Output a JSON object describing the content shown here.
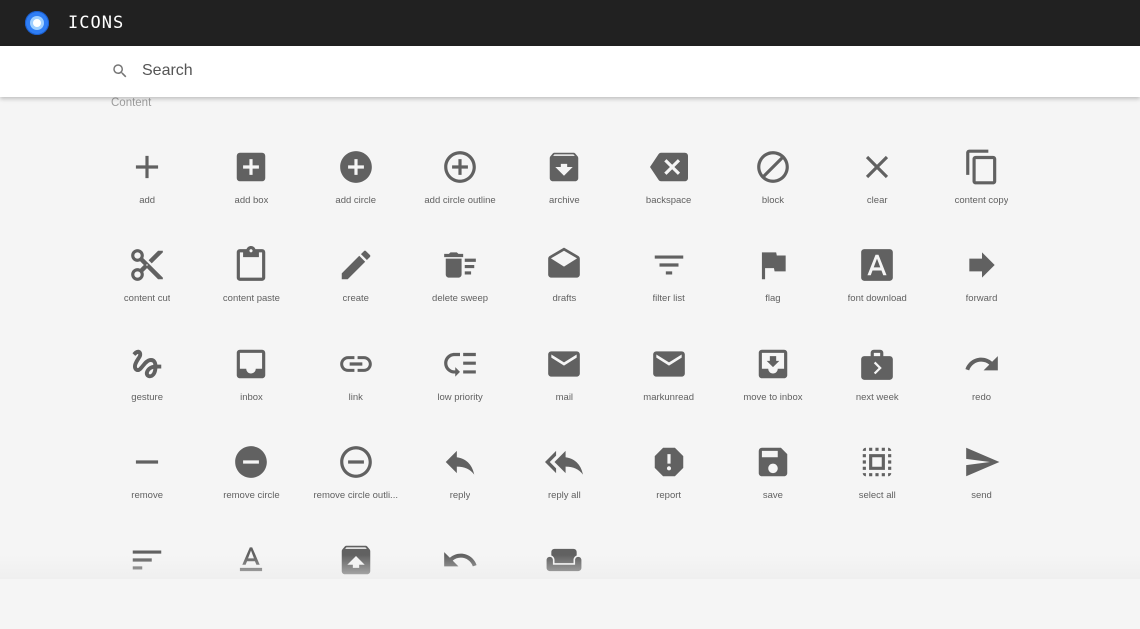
{
  "app": {
    "title": "ICONS"
  },
  "search": {
    "placeholder": "Search",
    "value": ""
  },
  "section": {
    "title": "Content"
  },
  "icon_color": "#616161",
  "icons": [
    {
      "label": "add",
      "icon": "add-icon"
    },
    {
      "label": "add box",
      "icon": "add-box-icon"
    },
    {
      "label": "add circle",
      "icon": "add-circle-icon"
    },
    {
      "label": "add circle outline",
      "icon": "add-circle-outline-icon"
    },
    {
      "label": "archive",
      "icon": "archive-icon"
    },
    {
      "label": "backspace",
      "icon": "backspace-icon"
    },
    {
      "label": "block",
      "icon": "block-icon"
    },
    {
      "label": "clear",
      "icon": "clear-icon"
    },
    {
      "label": "content copy",
      "icon": "content-copy-icon"
    },
    {
      "label": "content cut",
      "icon": "content-cut-icon"
    },
    {
      "label": "content paste",
      "icon": "content-paste-icon"
    },
    {
      "label": "create",
      "icon": "create-icon"
    },
    {
      "label": "delete sweep",
      "icon": "delete-sweep-icon"
    },
    {
      "label": "drafts",
      "icon": "drafts-icon"
    },
    {
      "label": "filter list",
      "icon": "filter-list-icon"
    },
    {
      "label": "flag",
      "icon": "flag-icon"
    },
    {
      "label": "font download",
      "icon": "font-download-icon"
    },
    {
      "label": "forward",
      "icon": "forward-icon"
    },
    {
      "label": "gesture",
      "icon": "gesture-icon"
    },
    {
      "label": "inbox",
      "icon": "inbox-icon"
    },
    {
      "label": "link",
      "icon": "link-icon"
    },
    {
      "label": "low priority",
      "icon": "low-priority-icon"
    },
    {
      "label": "mail",
      "icon": "mail-icon"
    },
    {
      "label": "markunread",
      "icon": "markunread-icon"
    },
    {
      "label": "move to inbox",
      "icon": "move-to-inbox-icon"
    },
    {
      "label": "next week",
      "icon": "next-week-icon"
    },
    {
      "label": "redo",
      "icon": "redo-icon"
    },
    {
      "label": "remove",
      "icon": "remove-icon"
    },
    {
      "label": "remove circle",
      "icon": "remove-circle-icon"
    },
    {
      "label": "remove circle outli...",
      "icon": "remove-circle-outline-icon"
    },
    {
      "label": "reply",
      "icon": "reply-icon"
    },
    {
      "label": "reply all",
      "icon": "reply-all-icon"
    },
    {
      "label": "report",
      "icon": "report-icon"
    },
    {
      "label": "save",
      "icon": "save-icon"
    },
    {
      "label": "select all",
      "icon": "select-all-icon"
    },
    {
      "label": "send",
      "icon": "send-icon"
    },
    {
      "label": "",
      "icon": "sort-icon"
    },
    {
      "label": "",
      "icon": "text-format-icon"
    },
    {
      "label": "",
      "icon": "unarchive-icon"
    },
    {
      "label": "",
      "icon": "undo-icon"
    },
    {
      "label": "",
      "icon": "weekend-icon"
    }
  ]
}
